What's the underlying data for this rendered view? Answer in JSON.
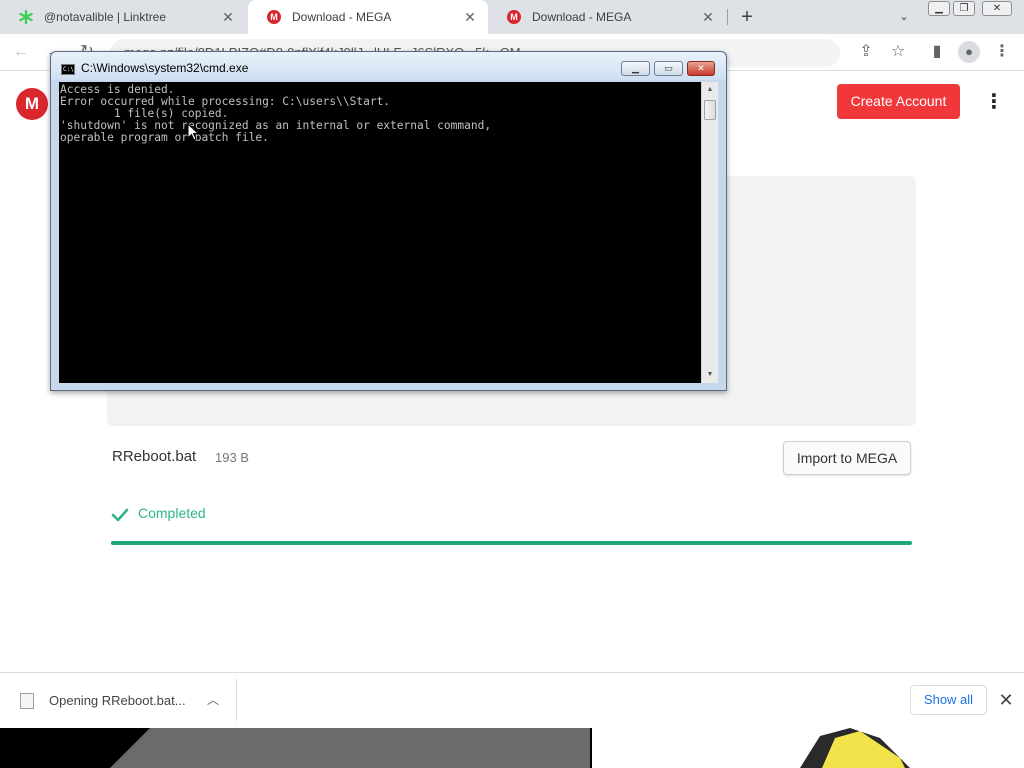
{
  "tabs": [
    {
      "title": "@notavalible | Linktree",
      "active": false,
      "favicon": "linktree-asterisk"
    },
    {
      "title": "Download - MEGA",
      "active": true,
      "favicon": "mega-logo"
    },
    {
      "title": "Download - MEGA",
      "active": false,
      "favicon": "mega-logo"
    }
  ],
  "omnibox": {
    "url": "mega.nz/file/8D1LPIZQ#D8-9nflXjf4kJ9llJ...lHLF...J6SlRXQ...5k...QM"
  },
  "header": {
    "logo_letter": "M",
    "create_account": "Create Account",
    "kebab": "⋮"
  },
  "file": {
    "name": "RReboot.bat",
    "size": "193 B",
    "import_button": "Import to MEGA",
    "status": "Completed",
    "progress_fraction": 1.0
  },
  "cmd": {
    "title": "C:\\Windows\\system32\\cmd.exe",
    "lines": [
      "Access is denied.",
      "Error occurred while processing: C:\\users\\\\Start.",
      "        1 file(s) copied.",
      "'shutdown' is not recognized as an internal or external command,",
      "operable program or batch file."
    ]
  },
  "download_bar": {
    "item_text": "Opening RReboot.bat...",
    "show_all": "Show all"
  },
  "colors": {
    "mega_red": "#d9272e",
    "create_account_bg": "#f0373a",
    "completed_green": "#2fb48a",
    "progress_green": "#1ea67a",
    "show_all_blue": "#1a73e8"
  }
}
